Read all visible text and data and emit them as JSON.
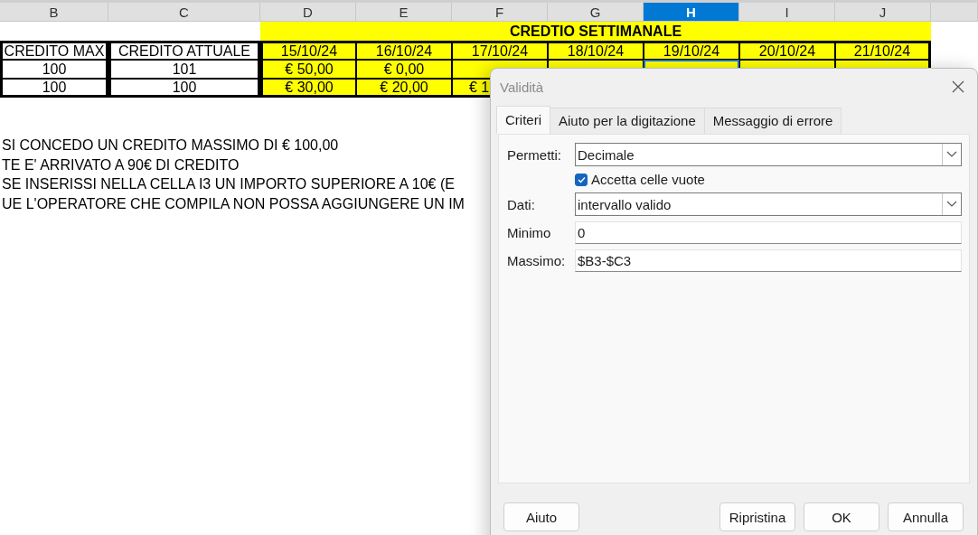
{
  "columns": [
    {
      "label": "B",
      "selected": false,
      "highlight": false
    },
    {
      "label": "C",
      "selected": false,
      "highlight": false
    },
    {
      "label": "D",
      "selected": false,
      "highlight": true
    },
    {
      "label": "E",
      "selected": false,
      "highlight": true
    },
    {
      "label": "F",
      "selected": false,
      "highlight": true
    },
    {
      "label": "G",
      "selected": false,
      "highlight": true
    },
    {
      "label": "H",
      "selected": true,
      "highlight": true
    },
    {
      "label": "I",
      "selected": false,
      "highlight": true
    },
    {
      "label": "J",
      "selected": false,
      "highlight": true
    }
  ],
  "title_row": {
    "text": "CREDTIO SETTIMANALE"
  },
  "rows": [
    [
      {
        "text": "CREDITO MAX",
        "selected": false
      },
      {
        "text": "CREDITO ATTUALE",
        "selected": false
      },
      {
        "text": "15/10/24",
        "selected": false
      },
      {
        "text": "16/10/24",
        "selected": false
      },
      {
        "text": "17/10/24",
        "selected": false
      },
      {
        "text": "18/10/24",
        "selected": false
      },
      {
        "text": "19/10/24",
        "selected": false
      },
      {
        "text": "20/10/24",
        "selected": false
      },
      {
        "text": "21/10/24",
        "selected": false
      }
    ],
    [
      {
        "text": "100",
        "selected": false
      },
      {
        "text": "101",
        "selected": false
      },
      {
        "text": "€ 50,00",
        "selected": false
      },
      {
        "text": "€ 0,00",
        "selected": false
      },
      {
        "selected": false
      },
      {
        "selected": false
      },
      {
        "selected": true
      },
      {
        "selected": false
      },
      {
        "selected": false
      }
    ],
    [
      {
        "text": "100",
        "selected": false
      },
      {
        "text": "100",
        "selected": false
      },
      {
        "text": "€ 30,00",
        "selected": false
      },
      {
        "text": "€ 20,00",
        "selected": false
      },
      {
        "text": "€ 1",
        "selected": false,
        "clipped": true
      }
    ]
  ],
  "notes": [
    "SI CONCEDO UN CREDITO MASSIMO DI € 100,00",
    "TE E' ARRIVATO A 90€ DI CREDITO",
    " SE INSERISSI NELLA CELLA I3 UN IMPORTO SUPERIORE A 10€ (E",
    "UE L'OPERATORE CHE COMPILA NON POSSA AGGIUNGERE UN IM"
  ],
  "dialog": {
    "title": "Validità",
    "tabs": [
      {
        "label": "Criteri",
        "selected": true
      },
      {
        "label": "Aiuto per la digitazione",
        "selected": false
      },
      {
        "label": "Messaggio di errore",
        "selected": false
      }
    ],
    "fields": [
      {
        "kind": "dropdown",
        "label": "Permetti:",
        "value": "Decimale"
      },
      {
        "kind": "checkbox",
        "label": "Accetta celle vuote",
        "checked": true
      },
      {
        "kind": "dropdown",
        "label": "Dati:",
        "value": "intervallo valido"
      },
      {
        "kind": "text",
        "label": "Minimo",
        "value": "0"
      },
      {
        "kind": "text",
        "label": "Massimo:",
        "value": "$B3-$C3"
      }
    ],
    "buttons": [
      "Aiuto",
      "Ripristina",
      "OK",
      "Annulla"
    ]
  }
}
